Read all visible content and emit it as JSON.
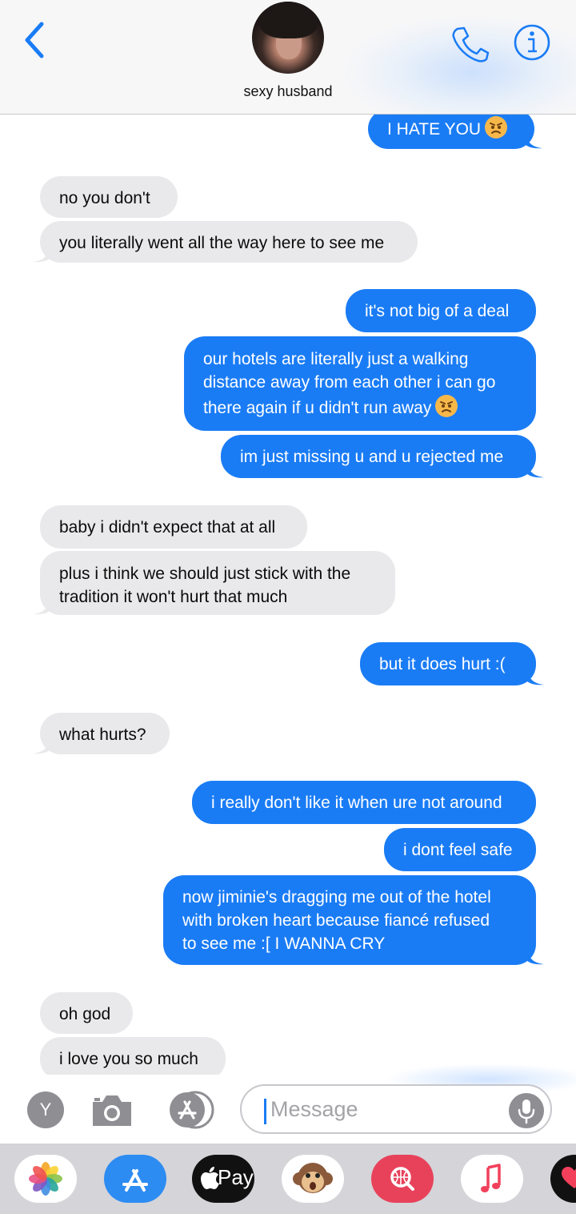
{
  "header": {
    "contact_name": "sexy husband",
    "accent_color": "#1a7cf5",
    "icons": [
      "chevron-left-icon",
      "phone-icon",
      "info-icon"
    ]
  },
  "messages": [
    {
      "side": "out",
      "lines": [
        "I HATE YOU"
      ],
      "emoji": "angry-face"
    },
    {
      "side": "in",
      "lines": [
        "no you don't"
      ]
    },
    {
      "side": "in",
      "lines": [
        "you literally went all the way here to see me"
      ]
    },
    {
      "side": "out",
      "lines": [
        "it's not big of a deal"
      ]
    },
    {
      "side": "out",
      "lines": [
        "our hotels are literally just a walking",
        "distance away from each other i can go",
        "there again if u didn't run away"
      ],
      "emoji": "angry-face"
    },
    {
      "side": "out",
      "lines": [
        "im just missing u and u rejected me"
      ]
    },
    {
      "side": "in",
      "lines": [
        "baby i didn't expect that at all"
      ]
    },
    {
      "side": "in",
      "lines": [
        "plus i think we should just stick with the",
        "tradition it won't hurt that much"
      ]
    },
    {
      "side": "out",
      "lines": [
        "but it does hurt :("
      ]
    },
    {
      "side": "in",
      "lines": [
        "what hurts?"
      ]
    },
    {
      "side": "out",
      "lines": [
        "i really don't like it when ure not around"
      ]
    },
    {
      "side": "out",
      "lines": [
        "i dont feel safe"
      ]
    },
    {
      "side": "out",
      "lines": [
        "now jiminie's dragging me out of the hotel",
        "with broken heart because fiancé refused",
        "to see me :[ I WANNA CRY"
      ]
    },
    {
      "side": "in",
      "lines": [
        "oh god"
      ]
    },
    {
      "side": "in",
      "lines": [
        "i love you so much"
      ]
    }
  ],
  "compose": {
    "avatar_initial": "Y",
    "placeholder": "Message"
  },
  "app_drawer": {
    "apple_pay_label": "Pay",
    "apps": [
      "photos-icon",
      "app-store-icon",
      "apple-pay-icon",
      "animoji-monkey-icon",
      "search-images-icon",
      "music-icon",
      "heart-app-icon"
    ]
  },
  "colors": {
    "incoming_bubble": "#e9e9eb",
    "outgoing_bubble": "#1a7cf5",
    "drawer_background": "#d4d4d9"
  }
}
